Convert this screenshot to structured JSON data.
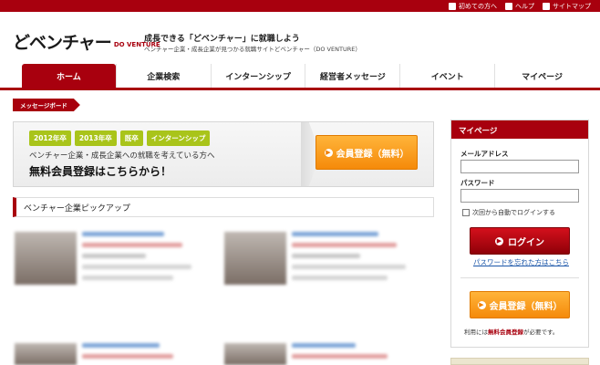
{
  "utility_nav": [
    {
      "label": "初めての方へ",
      "icon": "info-icon"
    },
    {
      "label": "ヘルプ",
      "icon": "question-icon"
    },
    {
      "label": "サイトマップ",
      "icon": "sitemap-icon"
    }
  ],
  "brand": {
    "logo_jp": "どベンチャー",
    "logo_en": "DO VENTURE",
    "tagline": "成長できる「どベンチャー」に就職しよう",
    "subtagline": "ベンチャー企業・成長企業が見つかる就職サイトどベンチャー（DO VENTURE）"
  },
  "nav": {
    "items": [
      "ホーム",
      "企業検索",
      "インターンシップ",
      "経営者メッセージ",
      "イベント",
      "マイページ"
    ],
    "active": 0
  },
  "breadcrumb": "メッセージボード",
  "banner": {
    "tags": [
      "2012年卒",
      "2013年卒",
      "既卒",
      "インターンシップ"
    ],
    "lead": "ベンチャー企業・成長企業への就職を考えている方へ",
    "main": "無料会員登録はこちらから！",
    "button": "会員登録（無料）"
  },
  "pickup": {
    "heading": "ベンチャー企業ピックアップ"
  },
  "sidebar": {
    "title": "マイページ",
    "email_label": "メールアドレス",
    "password_label": "パスワード",
    "auto_login": "次回から自動でログインする",
    "login_button": "ログイン",
    "forgot_link": "パスワードを忘れた方はこちら",
    "register_button": "会員登録（無料）",
    "note_pre": "利用には",
    "note_highlight": "無料会員登録",
    "note_post": "が必要です。"
  },
  "colors": {
    "brand_red": "#a8000e",
    "tag_green": "#a9c41a",
    "cta_orange": "#f58a0a",
    "link_blue": "#1a55a8"
  }
}
